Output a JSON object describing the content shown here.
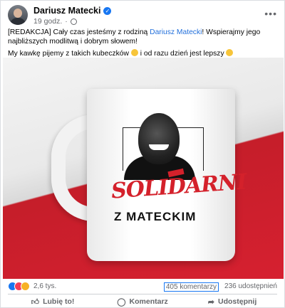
{
  "post": {
    "author": "Dariusz Matecki",
    "time": "19 godz.",
    "more_icon": "more-options-icon",
    "text_prefix": "[REDAKCJA] Cały czas jesteśmy z rodziną ",
    "text_link": "Dariusz Matecki",
    "text_suffix": "! Wspierajmy jego najbliższych modlitwą i dobrym słowem!",
    "text_line2": "My kawkę pijemy z takich kubeczków",
    "text_line2_b": " i od razu dzień jest lepszy"
  },
  "image": {
    "mug_brand": "SOLIDARNI",
    "mug_text": "Z MATECKIM",
    "colors": {
      "flag_red": "#d4212b",
      "flag_white": "#f4f4f4"
    }
  },
  "stats": {
    "reactions_count": "2,6 tys.",
    "comments": "405 komentarzy",
    "shares": "236 udostępnień"
  },
  "actions": {
    "like": "Lubię to!",
    "comment": "Komentarz",
    "share": "Udostępnij"
  },
  "colors": {
    "link": "#216fdb",
    "verified": "#1877f2",
    "muted": "#65676b"
  }
}
